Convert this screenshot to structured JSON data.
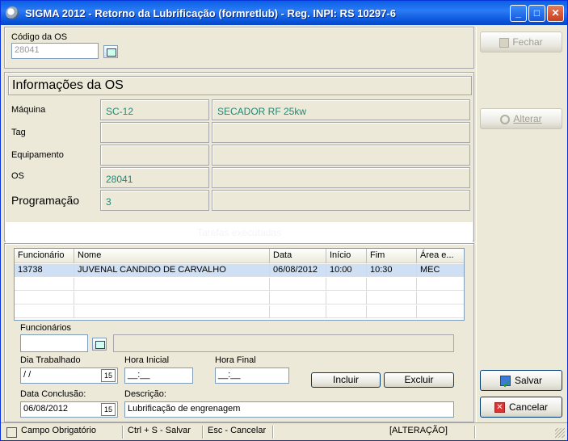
{
  "window": {
    "title": "SIGMA 2012 - Retorno da Lubrificação  (formretlub)  - Reg. INPI: RS 10297-6",
    "controls": {
      "minimize": "_",
      "maximize": "□",
      "close": "✕"
    }
  },
  "os_code": {
    "label": "Código da OS",
    "value": "28041"
  },
  "info": {
    "title": "Informações da OS",
    "rows": [
      {
        "label": "Máquina",
        "code": "SC-12",
        "description": "SECADOR RF 25kw"
      },
      {
        "label": "Tag",
        "code": "",
        "description": ""
      },
      {
        "label": "Equipamento",
        "code": "",
        "description": ""
      },
      {
        "label": "OS",
        "code": "28041",
        "description": ""
      },
      {
        "label": "Programação",
        "code": "3",
        "description": ""
      }
    ]
  },
  "section_bar": {
    "text": "Tarefas executadas"
  },
  "table": {
    "headers": [
      "Funcionário",
      "Nome",
      "Data",
      "Início",
      "Fim",
      "Área e..."
    ],
    "rows": [
      [
        "13738",
        "JUVENAL CANDIDO DE CARVALHO",
        "06/08/2012",
        "10:00",
        "10:30",
        "MEC"
      ]
    ]
  },
  "form": {
    "funcionarios_label": "Funcionários",
    "funcionarios_value": "",
    "funcionarios_name": "",
    "dia_trabalhado_label": "Dia Trabalhado",
    "dia_trabalhado_value": " / /",
    "hora_inicial_label": "Hora Inicial",
    "hora_inicial_value": "__:__",
    "hora_final_label": "Hora Final",
    "hora_final_value": "__:__",
    "incluir_label": "Incluir",
    "excluir_label": "Excluir",
    "data_conclusao_label": "Data Conclusão:",
    "data_conclusao_value": "06/08/2012",
    "descricao_label": "Descrição:",
    "descricao_value": "Lubrificação de engrenagem",
    "calendar_glyph": "15"
  },
  "side_buttons": {
    "fechar": "Fechar",
    "alterar": "Alterar",
    "salvar": "Salvar",
    "cancelar": "Cancelar"
  },
  "status": {
    "obrigatorio": "Campo Obrigatório",
    "salvar": "Ctrl + S - Salvar",
    "cancelar": "Esc - Cancelar",
    "mode": "[ALTERAÇÃO]"
  },
  "colors": {
    "accent": "#1d8a7a",
    "titlebar": "#0a5fe4",
    "selection": "#cfe0f4"
  }
}
